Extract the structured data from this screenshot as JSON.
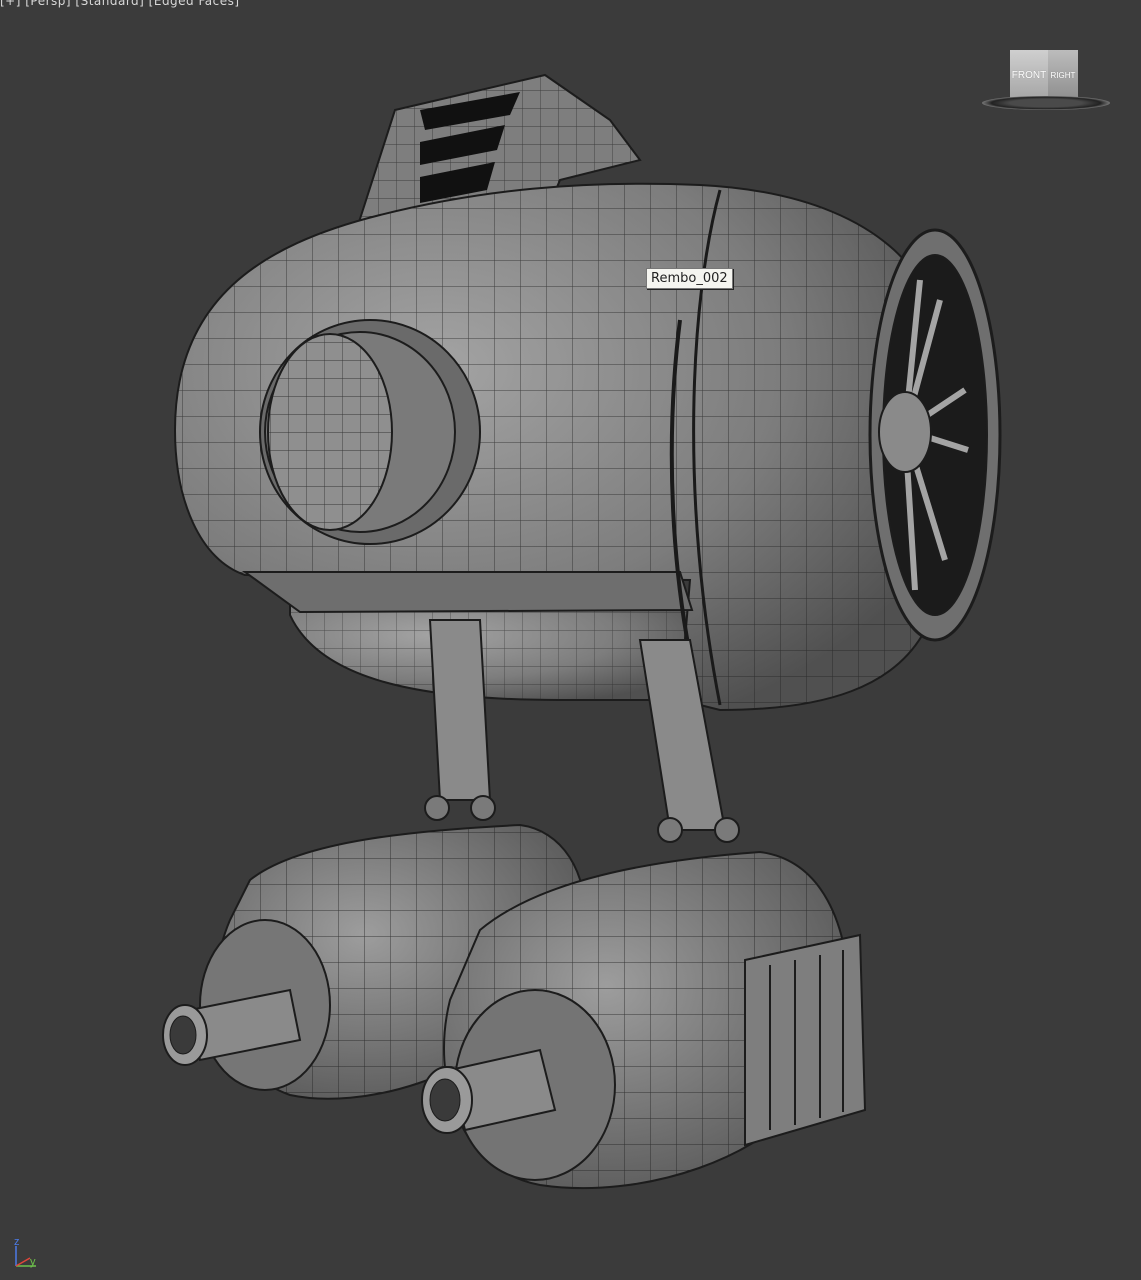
{
  "viewport": {
    "label": "[+] [Persp] [Standard] [Edged Faces]"
  },
  "object": {
    "tooltip_name": "Rembo_002"
  },
  "viewcube": {
    "front_label": "FRONT",
    "right_label": "RIGHT"
  },
  "axes": {
    "z": "z",
    "y": "y"
  },
  "colors": {
    "background": "#3b3b3b",
    "mesh_fill": "#8a8a8a",
    "wire": "#1a1a1a"
  }
}
